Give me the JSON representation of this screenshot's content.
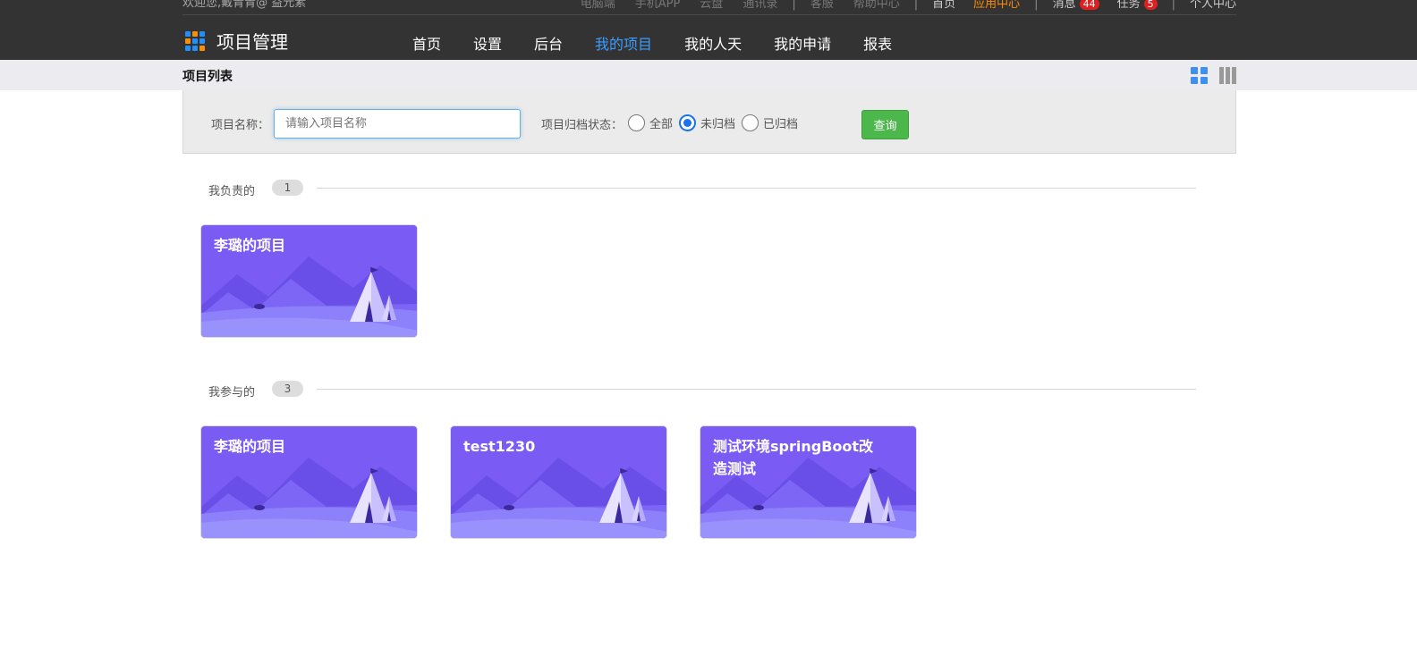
{
  "topbar": {
    "welcome": "欢迎您,戴青青@ 益元素",
    "links": [
      {
        "label": "电脑端"
      },
      {
        "label": "手机APP"
      },
      {
        "label": "云盘"
      },
      {
        "label": "通讯录"
      },
      {
        "label": "客服"
      },
      {
        "label": "帮助中心"
      },
      {
        "label": "首页"
      },
      {
        "label": "应用中心"
      },
      {
        "label": "消息",
        "badge": "44"
      },
      {
        "label": "任务",
        "badge": "5"
      },
      {
        "label": "个人中心"
      }
    ]
  },
  "logo": {
    "text": "项目管理",
    "colors": [
      "#1e90ff",
      "#ff8c00",
      "#1e90ff",
      "#ff8c00",
      "#1e90ff",
      "#1e90ff",
      "#1e90ff",
      "#1e90ff",
      "#ff8c00"
    ]
  },
  "nav": {
    "items": [
      "首页",
      "设置",
      "后台",
      "我的项目",
      "我的人天",
      "我的申请",
      "报表"
    ],
    "active_index": 3
  },
  "subbar": {
    "title": "项目列表"
  },
  "filter": {
    "name_label": "项目名称：",
    "name_placeholder": "请输入项目名称",
    "status_label": "项目归档状态：",
    "options": [
      "全部",
      "未归档",
      "已归档"
    ],
    "selected_index": 1,
    "query_label": "查询"
  },
  "sections": [
    {
      "label": "我负责的",
      "count": "1",
      "projects": [
        "李璐的项目"
      ]
    },
    {
      "label": "我参与的",
      "count": "3",
      "projects": [
        "李璐的项目",
        "test1230",
        "测试环境springBoot改造测试"
      ]
    }
  ],
  "colors": {
    "accent": "#3d9cff",
    "card_bg": "#7b5ff3",
    "query_btn": "#4cb84c",
    "highlight": "#ff8c00",
    "badge": "#e02020"
  }
}
